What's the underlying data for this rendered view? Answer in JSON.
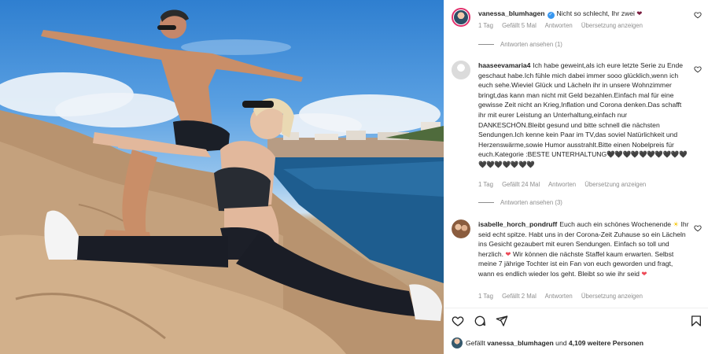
{
  "comments": [
    {
      "username": "vanessa_blumhagen",
      "verified": true,
      "text": "Nicht so schlecht, Ihr zwei",
      "emoji": "heart-dark",
      "time": "1 Tag",
      "likes": "Gefällt 5 Mal",
      "reply": "Antworten",
      "translate": "Übersetzung anzeigen",
      "view_replies": "Antworten ansehen (1)"
    },
    {
      "username": "haaseevamaria4",
      "text": "Ich habe geweint,als ich eure letzte Serie zu Ende geschaut habe.Ich fühle mich dabei immer sooo glücklich,wenn ich euch sehe.Wieviel Glück und Lächeln ihr in unsere Wohnzimmer bringt,das kann man nicht mit Geld bezahlen.Einfach mal für eine gewisse Zeit nicht an Krieg,Inflation und Corona denken.Das schafft ihr mit eurer Leistung an Unterhaltung,einfach nur DANKESCHÖN.Bleibt gesund und bitte schnell die nächsten Sendungen.Ich kenne kein Paar im TV,das soviel Natürlichkeit und Herzenswärme,sowie Humor ausstrahlt.Bitte einen Nobelpreis für euch.Kategorie :BESTE UNTERHALTUNG",
      "hearts": "🖤🖤🖤🖤🖤🖤🖤🖤🖤🖤🖤🖤🖤🖤🖤🖤🖤",
      "time": "1 Tag",
      "likes": "Gefällt 24 Mal",
      "reply": "Antworten",
      "translate": "Übersetzung anzeigen",
      "view_replies": "Antworten ansehen (3)"
    },
    {
      "username": "isabelle_horch_pondruff",
      "text_1": "Euch auch ein schönes Wochenende",
      "text_2": "Ihr seid echt spitze. Habt uns in der Corona-Zeit Zuhause so ein Lächeln ins Gesicht gezaubert mit euren Sendungen. Einfach so toll und herzlich.",
      "text_3": "Wir können die nächste Staffel kaum erwarten. Selbst meine 7 jährige Tochter ist ein Fan von euch geworden und fragt, wann es endlich wieder los geht. Bleibt so wie ihr seid",
      "time": "1 Tag",
      "likes": "Gefällt 2 Mal",
      "reply": "Antworten",
      "translate": "Übersetzung anzeigen"
    }
  ],
  "likes_summary": {
    "prefix": "Gefällt",
    "user": "vanessa_blumhagen",
    "and": "und",
    "count": "4,109 weitere Personen"
  },
  "icons": {
    "like": "heart-outline-icon",
    "comment": "comment-bubble-icon",
    "share": "paper-plane-icon",
    "save": "bookmark-icon"
  }
}
